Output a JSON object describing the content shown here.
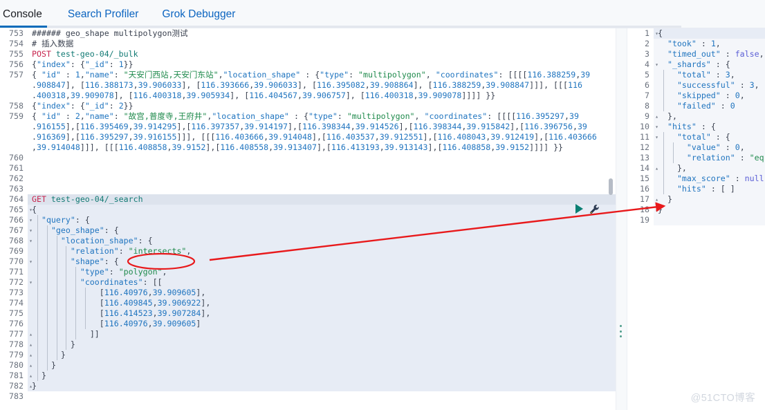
{
  "app": {
    "watermark": "@51CTO博客"
  },
  "tabs": [
    {
      "label": "Console",
      "active": true
    },
    {
      "label": "Search Profiler",
      "active": false
    },
    {
      "label": "Grok Debugger",
      "active": false
    }
  ],
  "toolbar": {
    "play_label": "Click to send request",
    "wrench_label": "Open documentation / settings",
    "play_icon": "play-triangle-icon",
    "wrench_icon": "wrench-icon"
  },
  "editor": {
    "first_line_number": 753,
    "active_line_number": 764,
    "selected_block": [
      764,
      782
    ],
    "lines": [
      {
        "n": 753,
        "text": "###### geo_shape multipolygon测试",
        "kind": "comment"
      },
      {
        "n": 754,
        "text": "# 插入数据",
        "kind": "comment"
      },
      {
        "n": 755,
        "method": "POST",
        "url": " test-geo-04/_bulk",
        "kind": "request"
      },
      {
        "n": 756,
        "text": "{\"index\": {\"_id\": 1}}",
        "kind": "json"
      },
      {
        "n": 757,
        "text": "{ \"id\" : 1,\"name\": \"天安门西站,天安门东站\",\"location_shape\" : {\"type\": \"multipolygon\", \"coordinates\": [[[[116.388259,39",
        "kind": "json"
      },
      {
        "n": null,
        "text": ".908847], [116.388173,39.906033], [116.393666,39.906033], [116.395082,39.908864], [116.388259,39.908847]]], [[[116",
        "kind": "wrap"
      },
      {
        "n": null,
        "text": ".400318,39.909078], [116.400318,39.905934], [116.404567,39.906757], [116.400318,39.909078]]]] }}",
        "kind": "wrap"
      },
      {
        "n": 758,
        "text": "{\"index\": {\"_id\": 2}}",
        "kind": "json"
      },
      {
        "n": 759,
        "text": "{ \"id\" : 2,\"name\": \"故宫,普度寺,王府井\",\"location_shape\" : {\"type\": \"multipolygon\", \"coordinates\": [[[[116.395297,39",
        "kind": "json"
      },
      {
        "n": null,
        "text": ".916155],[116.395469,39.914295],[116.397357,39.914197],[116.398344,39.914526],[116.398344,39.915842],[116.396756,39",
        "kind": "wrap"
      },
      {
        "n": null,
        "text": ".916369],[116.395297,39.916155]]], [[[116.403666,39.914048],[116.403537,39.912551],[116.408043,39.912419],[116.403666",
        "kind": "wrap"
      },
      {
        "n": null,
        "text": ",39.914048]]], [[[116.408858,39.9152],[116.408558,39.913407],[116.413193,39.913143],[116.408858,39.9152]]]] }}",
        "kind": "wrap"
      },
      {
        "n": 760,
        "text": "",
        "kind": "blank"
      },
      {
        "n": 761,
        "text": "",
        "kind": "blank"
      },
      {
        "n": 762,
        "text": "",
        "kind": "blank"
      },
      {
        "n": 763,
        "text": "",
        "kind": "blank"
      },
      {
        "n": 764,
        "method": "GET",
        "url": " test-geo-04/_search",
        "kind": "request"
      },
      {
        "n": 765,
        "text": "{",
        "kind": "json",
        "fold": "▾"
      },
      {
        "n": 766,
        "text": "  \"query\": {",
        "kind": "json",
        "fold": "▾"
      },
      {
        "n": 767,
        "text": "    \"geo_shape\": {",
        "kind": "json",
        "fold": "▾"
      },
      {
        "n": 768,
        "text": "      \"location_shape\": {",
        "kind": "json",
        "fold": "▾"
      },
      {
        "n": 769,
        "text": "        \"relation\": \"intersects\",",
        "kind": "json"
      },
      {
        "n": 770,
        "text": "        \"shape\": {",
        "kind": "json",
        "fold": "▾"
      },
      {
        "n": 771,
        "text": "          \"type\": \"polygon\",",
        "kind": "json"
      },
      {
        "n": 772,
        "text": "          \"coordinates\": [[",
        "kind": "json",
        "fold": "▾"
      },
      {
        "n": 773,
        "text": "              [116.40976,39.909605],",
        "kind": "json"
      },
      {
        "n": 774,
        "text": "              [116.409845,39.906922],",
        "kind": "json"
      },
      {
        "n": 775,
        "text": "              [116.414523,39.907284],",
        "kind": "json"
      },
      {
        "n": 776,
        "text": "              [116.40976,39.909605]",
        "kind": "json"
      },
      {
        "n": 777,
        "text": "            ]]",
        "kind": "json",
        "fold": "▴"
      },
      {
        "n": 778,
        "text": "        }",
        "kind": "json",
        "fold": "▴"
      },
      {
        "n": 779,
        "text": "      }",
        "kind": "json",
        "fold": "▴"
      },
      {
        "n": 780,
        "text": "    }",
        "kind": "json",
        "fold": "▴"
      },
      {
        "n": 781,
        "text": "  }",
        "kind": "json",
        "fold": "▴"
      },
      {
        "n": 782,
        "text": "}",
        "kind": "json",
        "fold": "▴"
      },
      {
        "n": 783,
        "text": "",
        "kind": "blank"
      }
    ]
  },
  "response": {
    "lines": [
      {
        "n": 1,
        "text": "{",
        "fold": "▾"
      },
      {
        "n": 2,
        "text": "  \"took\" : 1,"
      },
      {
        "n": 3,
        "text": "  \"timed_out\" : false,"
      },
      {
        "n": 4,
        "text": "  \"_shards\" : {",
        "fold": "▾"
      },
      {
        "n": 5,
        "text": "    \"total\" : 3,"
      },
      {
        "n": 6,
        "text": "    \"successful\" : 3,"
      },
      {
        "n": 7,
        "text": "    \"skipped\" : 0,"
      },
      {
        "n": 8,
        "text": "    \"failed\" : 0"
      },
      {
        "n": 9,
        "text": "  },",
        "fold": "▴"
      },
      {
        "n": 10,
        "text": "  \"hits\" : {",
        "fold": "▾"
      },
      {
        "n": 11,
        "text": "    \"total\" : {",
        "fold": "▾"
      },
      {
        "n": 12,
        "text": "      \"value\" : 0,"
      },
      {
        "n": 13,
        "text": "      \"relation\" : \"eq\""
      },
      {
        "n": 14,
        "text": "    },",
        "fold": "▴"
      },
      {
        "n": 15,
        "text": "    \"max_score\" : null,"
      },
      {
        "n": 16,
        "text": "    \"hits\" : [ ]"
      },
      {
        "n": 17,
        "text": "  }",
        "fold": "▴"
      },
      {
        "n": 18,
        "text": "}",
        "fold": "▴"
      },
      {
        "n": 19,
        "text": ""
      }
    ]
  },
  "annotations": {
    "highlight_term": "\"intersects\",",
    "ellipse_color": "#e8191b",
    "arrow_color": "#e8191b",
    "arrow_note": "arrow pointing from relation:intersects to the empty hits result"
  }
}
